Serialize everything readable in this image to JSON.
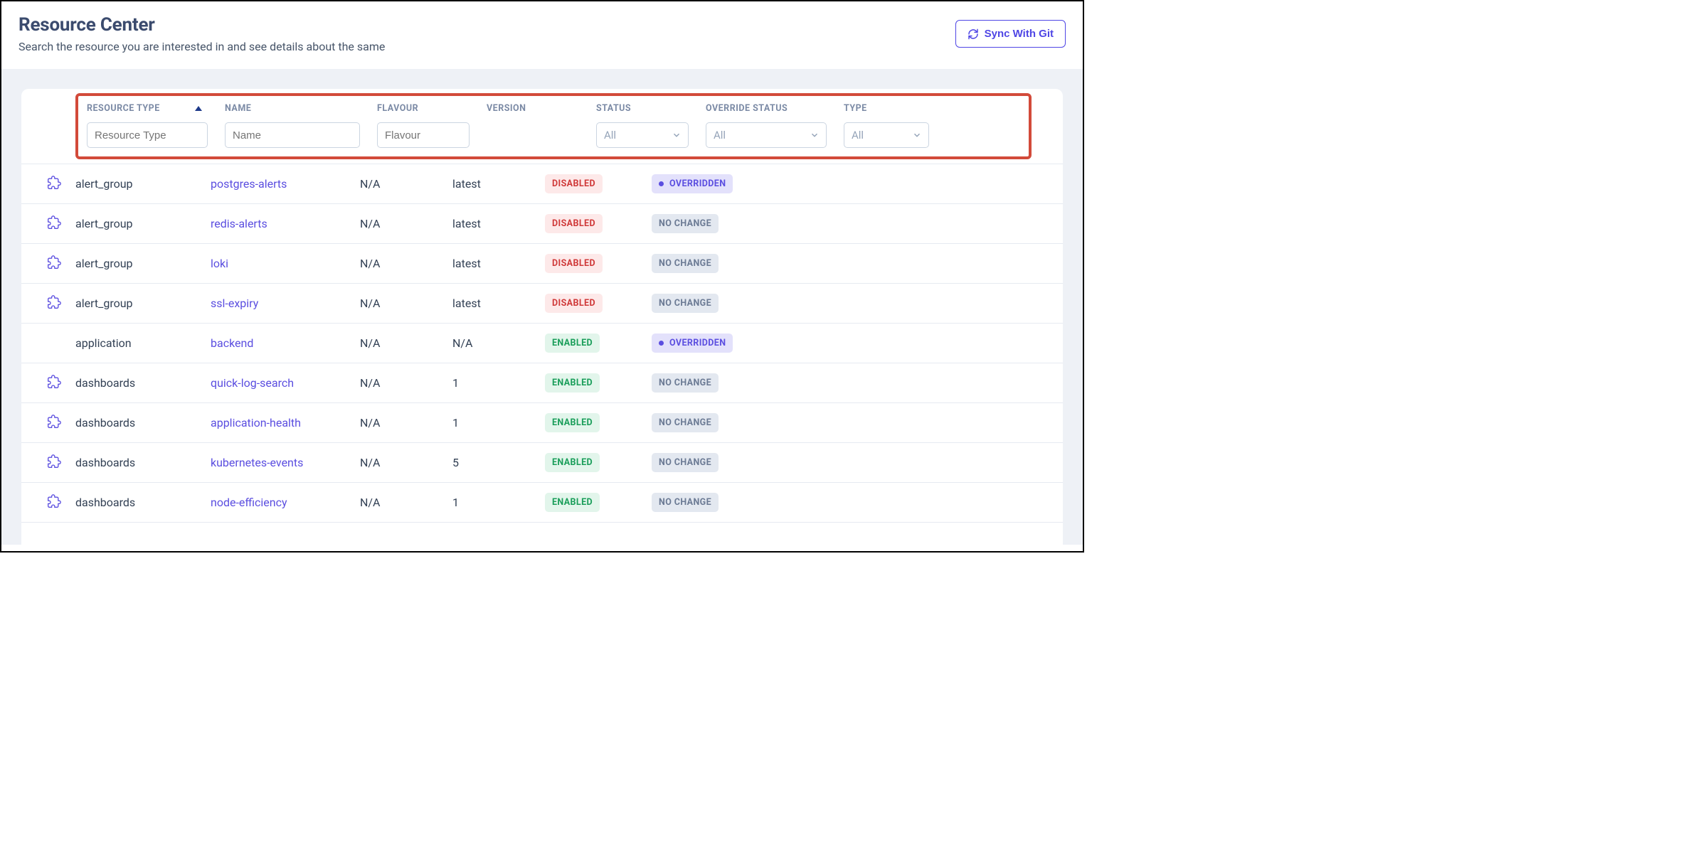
{
  "header": {
    "title": "Resource Center",
    "subtitle": "Search the resource you are interested in and see details about the same",
    "sync_button": "Sync With Git"
  },
  "columns": {
    "resource_type": "RESOURCE TYPE",
    "name": "NAME",
    "flavour": "FLAVOUR",
    "version": "VERSION",
    "status": "STATUS",
    "override_status": "OVERRIDE STATUS",
    "type": "TYPE"
  },
  "filters": {
    "resource_type_placeholder": "Resource Type",
    "name_placeholder": "Name",
    "flavour_placeholder": "Flavour",
    "status_value": "All",
    "override_status_value": "All",
    "type_value": "All"
  },
  "rows": [
    {
      "has_icon": true,
      "resource_type": "alert_group",
      "name": "postgres-alerts",
      "flavour": "N/A",
      "version": "latest",
      "status": "DISABLED",
      "override": "OVERRIDDEN"
    },
    {
      "has_icon": true,
      "resource_type": "alert_group",
      "name": "redis-alerts",
      "flavour": "N/A",
      "version": "latest",
      "status": "DISABLED",
      "override": "NO CHANGE"
    },
    {
      "has_icon": true,
      "resource_type": "alert_group",
      "name": "loki",
      "flavour": "N/A",
      "version": "latest",
      "status": "DISABLED",
      "override": "NO CHANGE"
    },
    {
      "has_icon": true,
      "resource_type": "alert_group",
      "name": "ssl-expiry",
      "flavour": "N/A",
      "version": "latest",
      "status": "DISABLED",
      "override": "NO CHANGE"
    },
    {
      "has_icon": false,
      "resource_type": "application",
      "name": "backend",
      "flavour": "N/A",
      "version": "N/A",
      "status": "ENABLED",
      "override": "OVERRIDDEN"
    },
    {
      "has_icon": true,
      "resource_type": "dashboards",
      "name": "quick-log-search",
      "flavour": "N/A",
      "version": "1",
      "status": "ENABLED",
      "override": "NO CHANGE"
    },
    {
      "has_icon": true,
      "resource_type": "dashboards",
      "name": "application-health",
      "flavour": "N/A",
      "version": "1",
      "status": "ENABLED",
      "override": "NO CHANGE"
    },
    {
      "has_icon": true,
      "resource_type": "dashboards",
      "name": "kubernetes-events",
      "flavour": "N/A",
      "version": "5",
      "status": "ENABLED",
      "override": "NO CHANGE"
    },
    {
      "has_icon": true,
      "resource_type": "dashboards",
      "name": "node-efficiency",
      "flavour": "N/A",
      "version": "1",
      "status": "ENABLED",
      "override": "NO CHANGE"
    }
  ]
}
